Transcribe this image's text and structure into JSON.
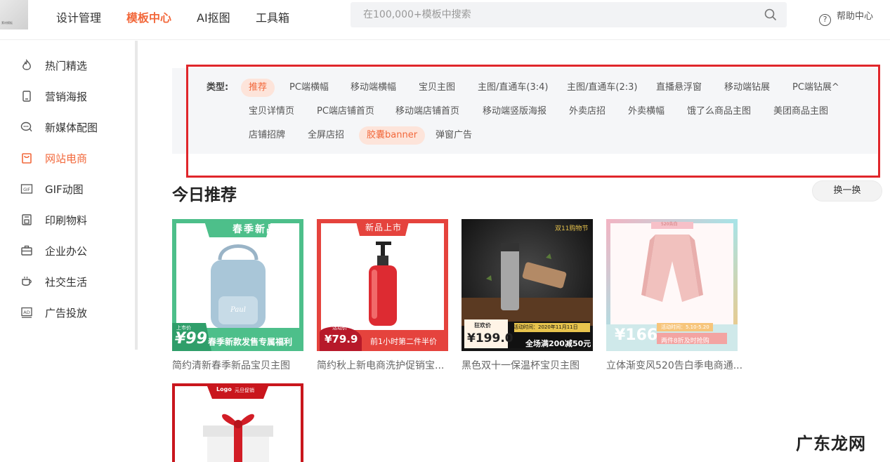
{
  "header": {
    "logo_text": "素材模板",
    "nav": [
      "设计管理",
      "模板中心",
      "AI抠图",
      "工具箱"
    ],
    "active_nav": "模板中心",
    "search_placeholder": "在100,000+模板中搜索",
    "help_label": "帮助中心"
  },
  "sidebar": {
    "items": [
      {
        "label": "热门精选",
        "icon": "flame-icon"
      },
      {
        "label": "营销海报",
        "icon": "phone-icon"
      },
      {
        "label": "新媒体配图",
        "icon": "chat-icon"
      },
      {
        "label": "网站电商",
        "icon": "shopping-bag-icon"
      },
      {
        "label": "GIF动图",
        "icon": "gif-icon"
      },
      {
        "label": "印刷物料",
        "icon": "printer-icon"
      },
      {
        "label": "企业办公",
        "icon": "briefcase-icon"
      },
      {
        "label": "社交生活",
        "icon": "coffee-cup-icon"
      },
      {
        "label": "广告投放",
        "icon": "ad-icon"
      }
    ],
    "active": "网站电商"
  },
  "filter": {
    "type_label": "类型:",
    "rows": [
      [
        "推荐",
        "PC端横幅",
        "移动端横幅",
        "宝贝主图",
        "主图/直通车(3:4)",
        "主图/直通车(2:3)",
        "直播悬浮窗",
        "移动端钻展",
        "PC端钻展^"
      ],
      [
        "宝贝详情页",
        "PC端店铺首页",
        "移动端店铺首页",
        "移动端竖版海报",
        "外卖店招",
        "外卖横幅",
        "饿了么商品主图",
        "美团商品主图"
      ],
      [
        "店铺招牌",
        "全屏店招",
        "胶囊banner",
        "弹窗广告"
      ]
    ],
    "selected": [
      "推荐",
      "胶囊banner"
    ]
  },
  "recommend": {
    "title": "今日推荐",
    "swap_label": "换一换",
    "cards": [
      {
        "title": "简约清新春季新品宝贝主图",
        "tag": "春季新品",
        "price_prefix": "上市价",
        "price": "¥99",
        "promo": "春季新款发售专属福利",
        "color": "#4dbf8a"
      },
      {
        "title": "简约秋上新电商洗护促销宝...",
        "tag": "新品上市",
        "price_prefix": "活动价",
        "price": "¥79.9",
        "promo": "前1小时第二件半价",
        "color": "#e5433d"
      },
      {
        "title": "黑色双十一保温杯宝贝主图",
        "tag": "双11购物节",
        "price_prefix": "狂欢价",
        "price": "¥199.0",
        "promo": "全场满200减50元",
        "extra": "活动时间：2020年11月11日",
        "color": "#222222"
      },
      {
        "title": "立体渐变风520告白季电商通...",
        "tag": "520告白",
        "price": "¥166",
        "promo": "两件8折及时抢购",
        "extra": "活动时间：5.10-5.20",
        "color": "#7ed3d8"
      },
      {
        "title": "",
        "tag": "元旦促销",
        "logo": "Logo",
        "color": "#c9161d"
      }
    ]
  },
  "watermark": "广东龙网"
}
